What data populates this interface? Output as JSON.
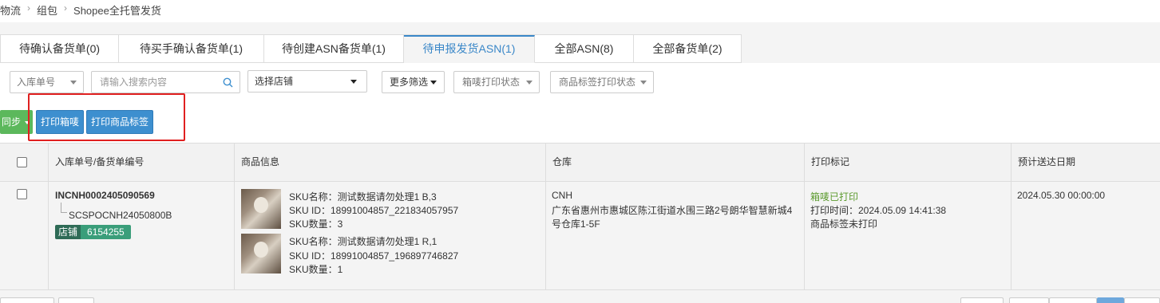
{
  "breadcrumb": [
    "物流",
    "组包",
    "Shopee全托管发货"
  ],
  "tabs": [
    {
      "label": "待确认备货单(0)"
    },
    {
      "label": "待买手确认备货单(1)"
    },
    {
      "label": "待创建ASN备货单(1)"
    },
    {
      "label": "待申报发货ASN(1)",
      "active": true
    },
    {
      "label": "全部ASN(8)"
    },
    {
      "label": "全部备货单(2)"
    }
  ],
  "filters": {
    "search_type": "入库单号",
    "search_placeholder": "请输入搜索内容",
    "store_select": "选择店铺",
    "more_filters": "更多筛选",
    "box_print_status": "箱唛打印状态",
    "label_print_status": "商品标签打印状态"
  },
  "actions": {
    "sync": "同步",
    "print_box_label": "打印箱唛",
    "print_product_label": "打印商品标签"
  },
  "table": {
    "columns": [
      "入库单号/备货单编号",
      "商品信息",
      "仓库",
      "打印标记",
      "预计送达日期"
    ],
    "rows": [
      {
        "inbound_no": "INCNH0002405090569",
        "stock_no": "SCSPOCNH24050800B",
        "store_tag": "店铺",
        "store_id": "6154255",
        "products": [
          {
            "sku_name": "SKU名称：测试数据请勿处理1 B,3",
            "sku_id": "SKU ID：18991004857_221834057957",
            "sku_qty": "SKU数量：3"
          },
          {
            "sku_name": "SKU名称：测试数据请勿处理1 R,1",
            "sku_id": "SKU ID：18991004857_196897746827",
            "sku_qty": "SKU数量：1"
          }
        ],
        "warehouse_code": "CNH",
        "warehouse_addr_line1": "广东省惠州市惠城区陈江街道水围三路2号朗华智慧新城4",
        "warehouse_addr_line2": "号仓库1-5F",
        "print_status": "箱唛已打印",
        "print_time": "打印时间：2024.05.09 14:41:38",
        "label_status": "商品标签未打印",
        "eta": "2024.05.30 00:00:00"
      }
    ]
  },
  "colors": {
    "accent_blue": "#3d8fcf",
    "active_tab": "#3a87c8",
    "printed_green": "#5b9a2e",
    "highlight_red": "#e02020",
    "sync_green": "#5cb85c"
  }
}
